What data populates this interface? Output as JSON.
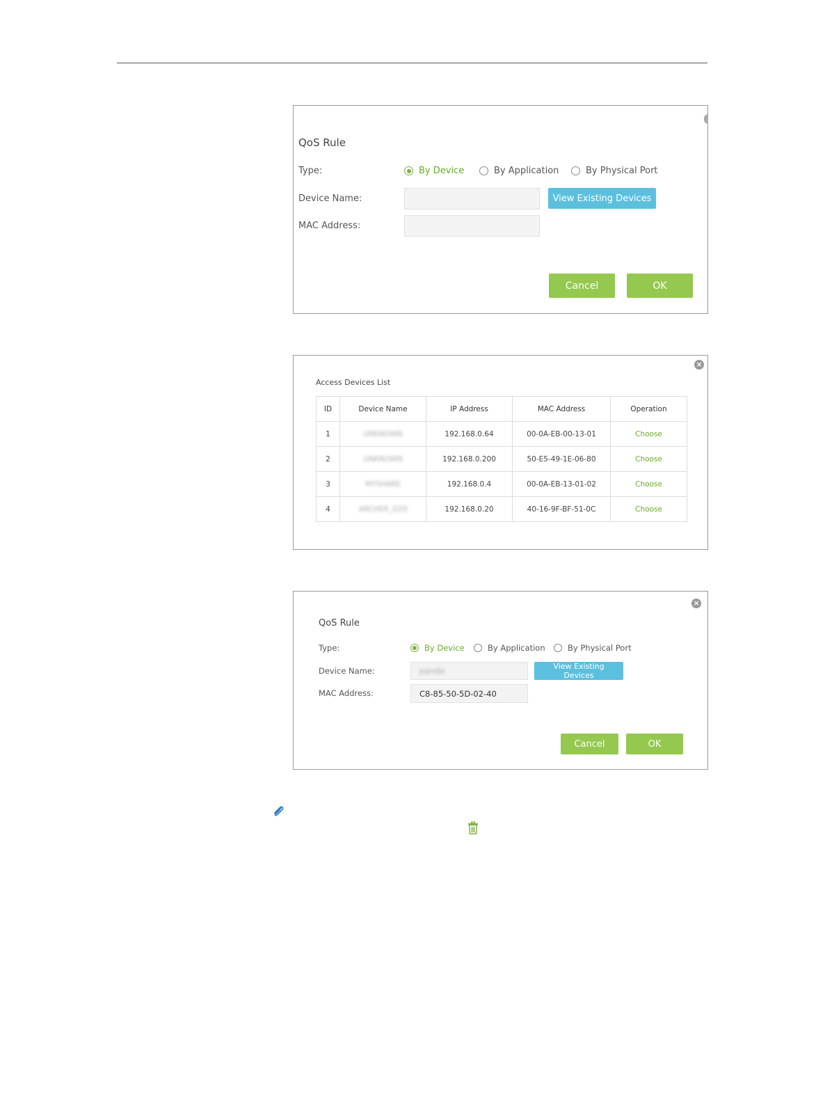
{
  "dialog1": {
    "title": "QoS Rule",
    "type_label": "Type:",
    "options": [
      "By Device",
      "By Application",
      "By Physical Port"
    ],
    "selected": "By Device",
    "device_name_label": "Device Name:",
    "device_name_value": "",
    "mac_label": "MAC Address:",
    "mac_value": "",
    "view_button": "View Existing Devices",
    "cancel": "Cancel",
    "ok": "OK"
  },
  "dialog2": {
    "title": "Access Devices List",
    "columns": [
      "ID",
      "Device Name",
      "IP Address",
      "MAC Address",
      "Operation"
    ],
    "rows": [
      {
        "id": "1",
        "name": "UNKNOWN",
        "ip": "192.168.0.64",
        "mac": "00-0A-EB-00-13-01",
        "op": "Choose"
      },
      {
        "id": "2",
        "name": "UNKNOWN",
        "ip": "192.168.0.200",
        "mac": "50-E5-49-1E-06-80",
        "op": "Choose"
      },
      {
        "id": "3",
        "name": "MYSHARE",
        "ip": "192.168.0.4",
        "mac": "00-0A-EB-13-01-02",
        "op": "Choose"
      },
      {
        "id": "4",
        "name": "ARCHER_D20",
        "ip": "192.168.0.20",
        "mac": "40-16-9F-BF-51-0C",
        "op": "Choose"
      }
    ]
  },
  "dialog3": {
    "title": "QoS Rule",
    "type_label": "Type:",
    "options": [
      "By Device",
      "By Application",
      "By Physical Port"
    ],
    "selected": "By Device",
    "device_name_label": "Device Name:",
    "device_name_value": "panda",
    "mac_label": "MAC Address:",
    "mac_value": "C8-85-50-5D-02-40",
    "view_button": "View Existing Devices",
    "cancel": "Cancel",
    "ok": "OK"
  },
  "icons": {
    "note": "paperclip-icon",
    "delete": "trash-icon"
  },
  "colors": {
    "accent_green": "#94c84f",
    "accent_blue": "#5bc0de",
    "selected_text": "#6aaa2a"
  }
}
